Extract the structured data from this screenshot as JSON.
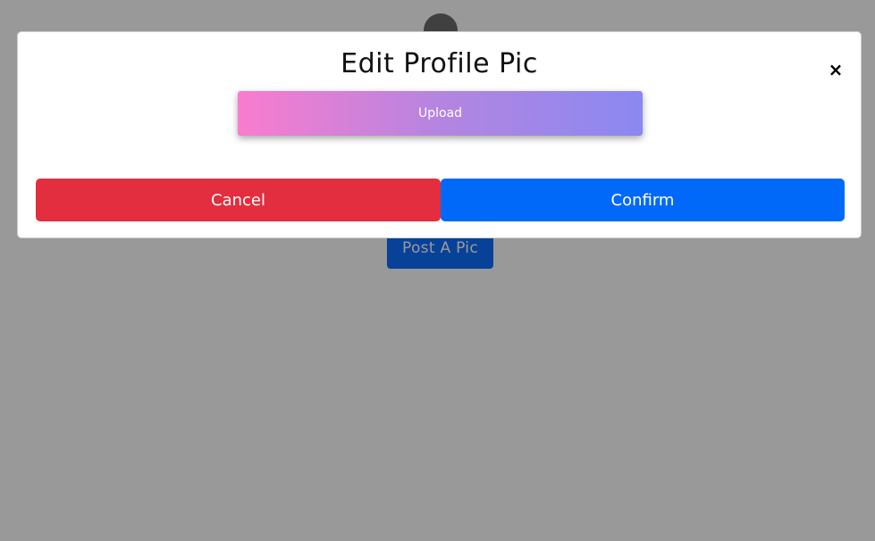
{
  "page": {
    "post_button_label": "Post A Pic"
  },
  "modal": {
    "title": "Edit Profile Pic",
    "close_label": "×",
    "upload_label": "Upload",
    "cancel_label": "Cancel",
    "confirm_label": "Confirm"
  },
  "colors": {
    "backdrop": "rgba(0,0,0,0.4)",
    "cancel": "#e22e3f",
    "confirm": "#0069f9",
    "post": "#0d6efd",
    "upload_gradient_start": "#fa7cce",
    "upload_gradient_end": "#8a88f1"
  }
}
